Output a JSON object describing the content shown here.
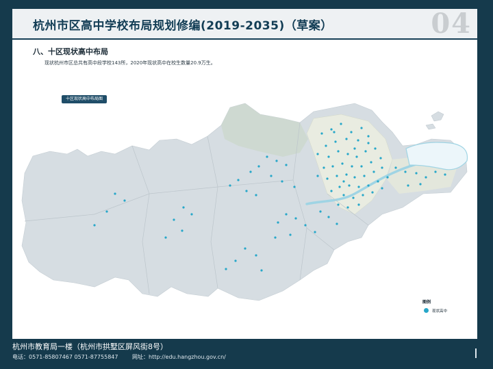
{
  "header": {
    "title": "杭州市区高中学校布局规划修编(2019-2035)（草案）",
    "page_number": "04"
  },
  "section": {
    "heading": "八、十区现状高中布局",
    "description": "现状杭州市区总共有高中段学校143所，2020年现状高中在校生数量20.9万生。"
  },
  "map": {
    "badge_label": "十区现状高中布局图",
    "land_color": "#d6dde2",
    "urban_color": "#e9ece1",
    "river_color": "#9fd4e4",
    "school_color": "#27a7c9"
  },
  "legend": {
    "title": "图例",
    "item_label": "现状高中",
    "item_icon": "circle-dot-icon"
  },
  "footer": {
    "address": "杭州市教育局一楼（杭州市拱墅区屏风街8号）",
    "phone": "电话：0571-85807467  0571-87755847",
    "website": "网址：http://edu.hangzhou.gov.cn/"
  }
}
